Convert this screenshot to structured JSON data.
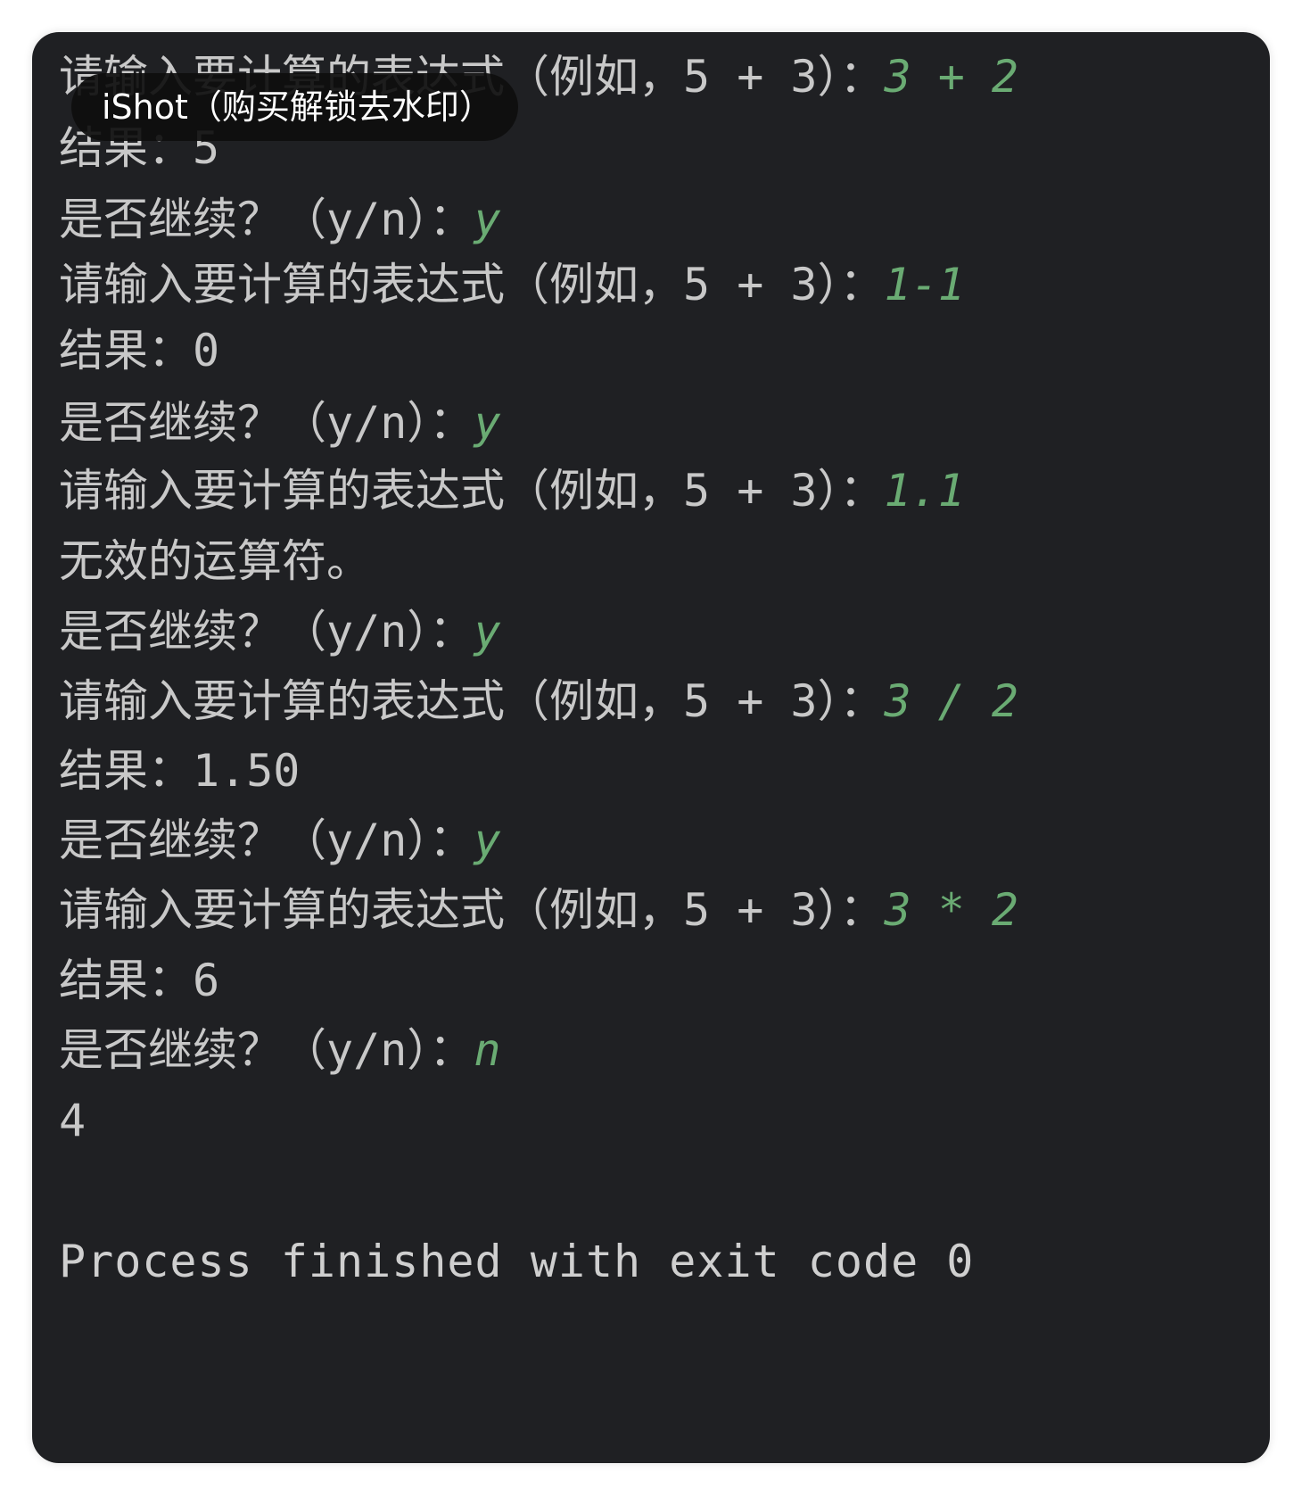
{
  "console": {
    "lines": [
      {
        "prompt": "请输入要计算的表达式（例如，5 + 3）：",
        "input": "3 + 2"
      },
      {
        "prompt": "结果：5",
        "input": ""
      },
      {
        "prompt": "是否继续？（y/n）：",
        "input": "y"
      },
      {
        "prompt": "请输入要计算的表达式（例如，5 + 3）：",
        "input": "1-1"
      },
      {
        "prompt": "结果：0",
        "input": ""
      },
      {
        "prompt": "是否继续？（y/n）：",
        "input": "y"
      },
      {
        "prompt": "请输入要计算的表达式（例如，5 + 3）：",
        "input": "1.1"
      },
      {
        "prompt": "无效的运算符。",
        "input": ""
      },
      {
        "prompt": "是否继续？（y/n）：",
        "input": "y"
      },
      {
        "prompt": "请输入要计算的表达式（例如，5 + 3）：",
        "input": "3 / 2"
      },
      {
        "prompt": "结果：1.50",
        "input": ""
      },
      {
        "prompt": "是否继续？（y/n）：",
        "input": "y"
      },
      {
        "prompt": "请输入要计算的表达式（例如，5 + 3）：",
        "input": "3 * 2"
      },
      {
        "prompt": "结果：6",
        "input": ""
      },
      {
        "prompt": "是否继续？（y/n）：",
        "input": "n"
      },
      {
        "prompt": "4",
        "input": ""
      }
    ],
    "finished": "Process finished with exit code 0"
  },
  "watermark": "iShot（购买解锁去水印）",
  "colors": {
    "background": "#1f2023",
    "text": "#c8c8c8",
    "user_input": "#6aab73"
  }
}
